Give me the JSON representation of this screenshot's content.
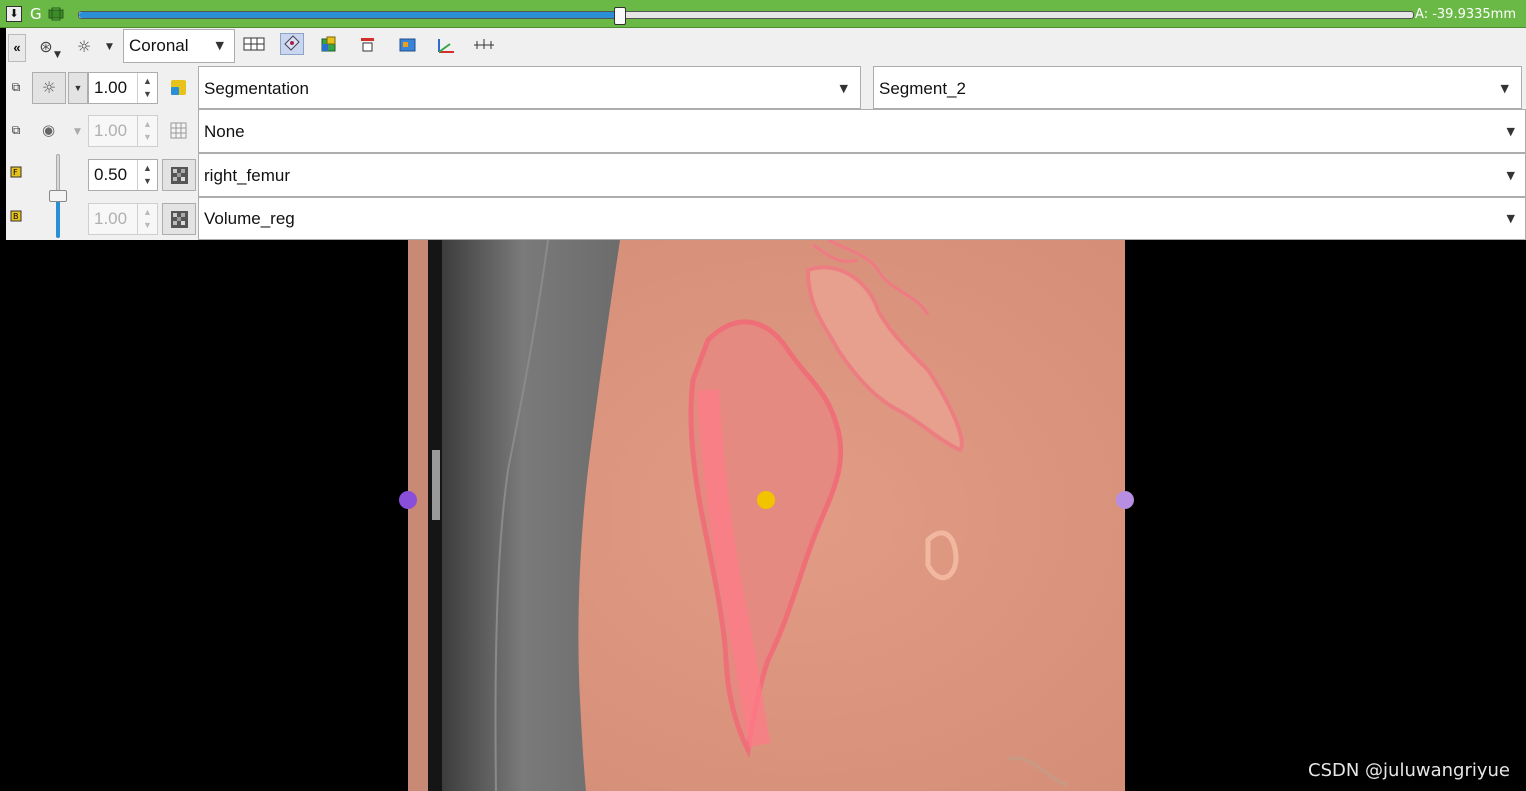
{
  "slice_bar": {
    "pin_icon": "pin-icon",
    "view_name": "G",
    "link_icon": "link-icon",
    "slice_position_fraction": 0.405,
    "slice_offset": "A: -39.9335mm",
    "color": "#6ab947"
  },
  "toolbar": {
    "collapse_label": "«",
    "orientation": "Coronal",
    "icons": [
      "crosshair-icon",
      "visibility-icon",
      "layout-grid-icon",
      "reformat-icon",
      "model-icon",
      "fit-icon",
      "lightbox-icon",
      "axes-icon",
      "ruler-icon"
    ]
  },
  "layers": {
    "label_layer": {
      "opacity": "1.00",
      "volume": "Segmentation",
      "segment": "Segment_2"
    },
    "label_map_layer": {
      "opacity": "1.00",
      "volume": "None"
    },
    "foreground_layer": {
      "opacity": "0.50",
      "volume": "right_femur"
    },
    "background_layer": {
      "opacity": "1.00",
      "volume": "Volume_reg"
    },
    "fg_bg_blend_fraction": 0.5
  },
  "viewport": {
    "marker_colors": [
      "#8a4fd8",
      "#f2c400",
      "#b68fe3"
    ]
  },
  "watermark": "CSDN @juluwangriyue"
}
